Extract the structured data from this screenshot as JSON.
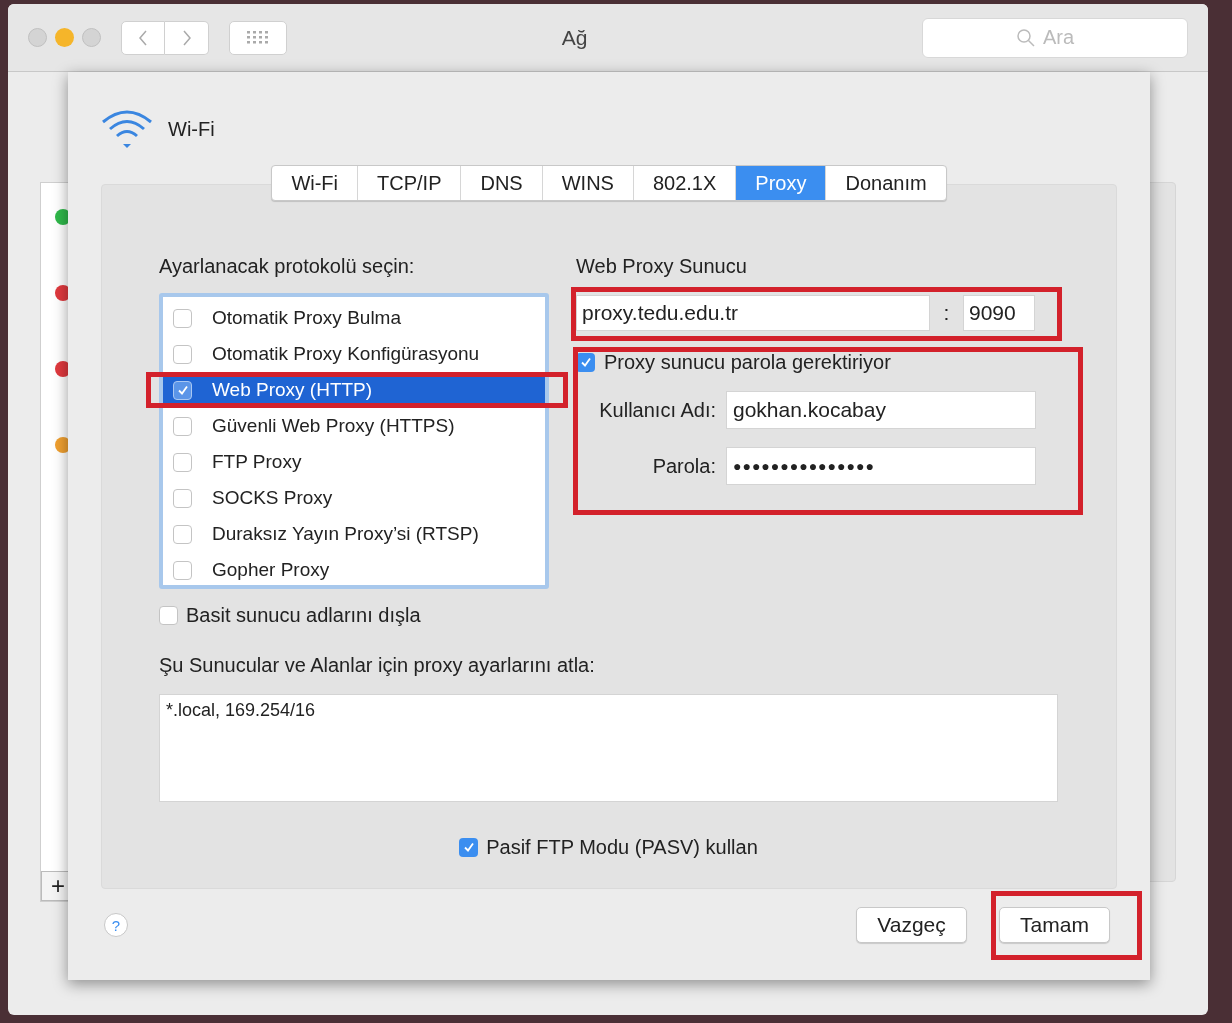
{
  "window": {
    "title": "Ağ",
    "search": {
      "placeholder": "Ara"
    }
  },
  "background_services": [
    {
      "color": "#2fb84a"
    },
    {
      "color": "#e0393e"
    },
    {
      "color": "#e0393e"
    },
    {
      "color": "#f0a030"
    }
  ],
  "background_add_button": "+",
  "sheet": {
    "interface": "Wi-Fi",
    "tabs": [
      {
        "label": "Wi-Fi",
        "selected": false
      },
      {
        "label": "TCP/IP",
        "selected": false
      },
      {
        "label": "DNS",
        "selected": false
      },
      {
        "label": "WINS",
        "selected": false
      },
      {
        "label": "802.1X",
        "selected": false
      },
      {
        "label": "Proxy",
        "selected": true
      },
      {
        "label": "Donanım",
        "selected": false
      }
    ],
    "protocols_label": "Ayarlanacak protokolü seçin:",
    "protocols": [
      {
        "label": "Otomatik Proxy Bulma",
        "checked": false,
        "selected": false
      },
      {
        "label": "Otomatik Proxy Konfigürasyonu",
        "checked": false,
        "selected": false
      },
      {
        "label": "Web Proxy (HTTP)",
        "checked": true,
        "selected": true
      },
      {
        "label": "Güvenli Web Proxy (HTTPS)",
        "checked": false,
        "selected": false
      },
      {
        "label": "FTP Proxy",
        "checked": false,
        "selected": false
      },
      {
        "label": "SOCKS Proxy",
        "checked": false,
        "selected": false
      },
      {
        "label": "Duraksız Yayın Proxy’si (RTSP)",
        "checked": false,
        "selected": false
      },
      {
        "label": "Gopher Proxy",
        "checked": false,
        "selected": false
      }
    ],
    "server_label": "Web Proxy Sunucu",
    "server": "proxy.tedu.edu.tr",
    "port_separator": ":",
    "port": "9090",
    "password_required": {
      "label": "Proxy sunucu parola gerektiriyor",
      "checked": true
    },
    "username_label": "Kullanıcı Adı:",
    "username": "gokhan.kocabay",
    "password_label": "Parola:",
    "password": "●●●●●●●●●●●●●●●",
    "exclude_simple": {
      "label": "Basit sunucu adlarını dışla",
      "checked": false
    },
    "bypass_label": "Şu Sunucular ve Alanlar için proxy ayarlarını atla:",
    "bypass": "*.local, 169.254/16",
    "passive_ftp": {
      "label": "Pasif FTP Modu (PASV) kullan",
      "checked": true
    },
    "help": "?",
    "buttons": [
      {
        "label": "Vazgeç"
      },
      {
        "label": "Tamam"
      }
    ]
  }
}
